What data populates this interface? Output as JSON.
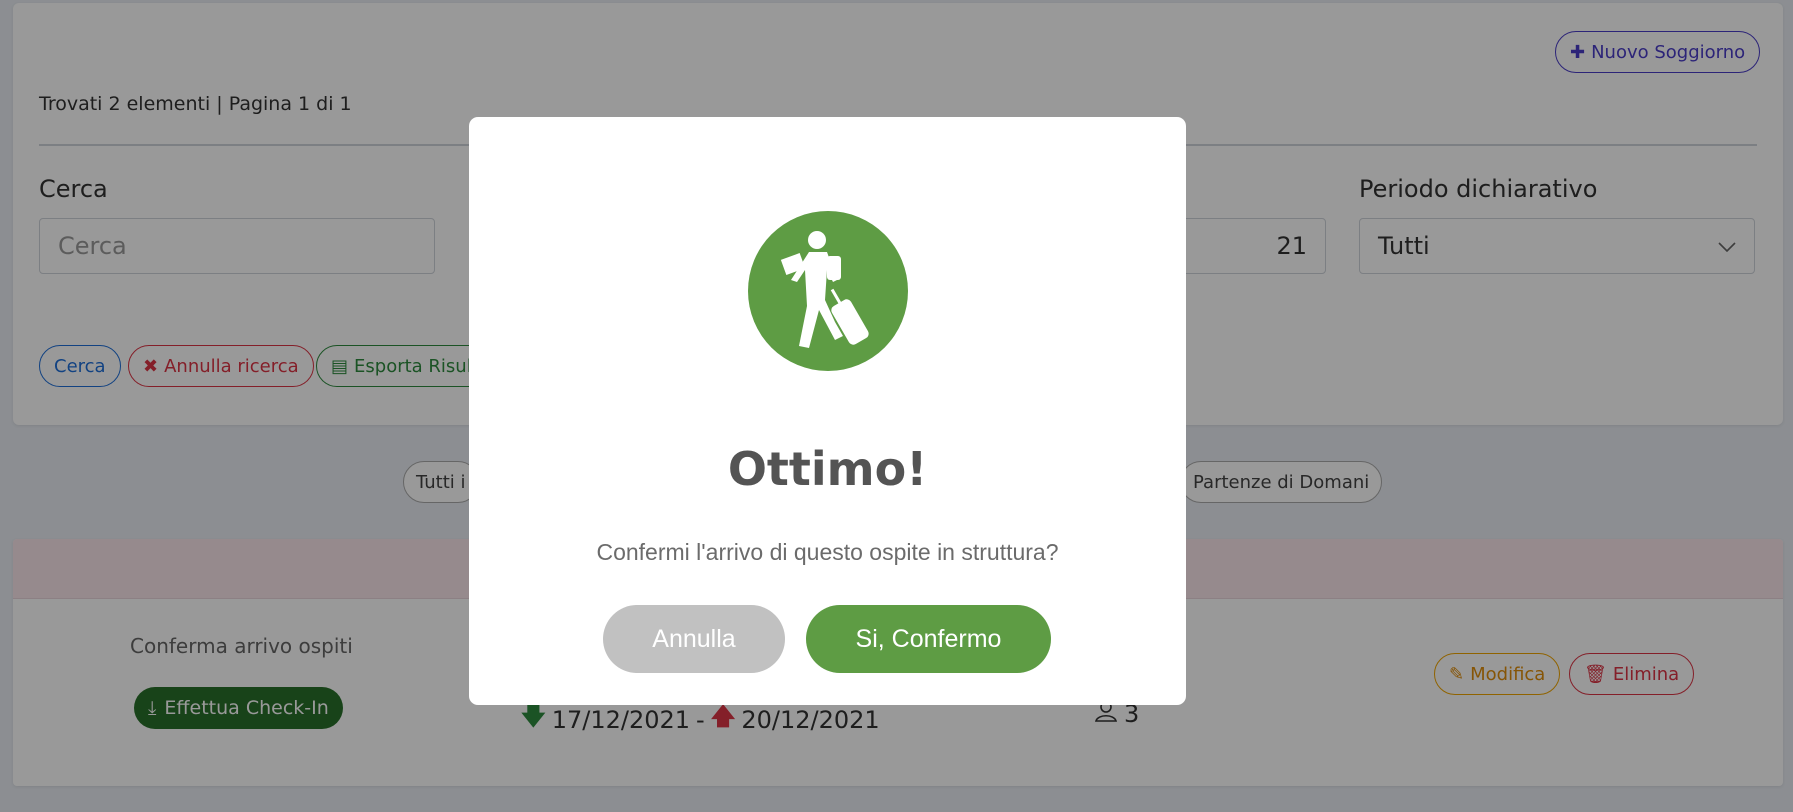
{
  "header": {
    "new_stay_button": "Nuovo Soggiorno",
    "found_text": "Trovati 2 elementi | Pagina 1 di 1"
  },
  "filters": {
    "search_label": "Cerca",
    "search_placeholder": "Cerca",
    "date_partial": "21",
    "period_label": "Periodo dichiarativo",
    "period_value": "Tutti"
  },
  "actions": {
    "search_button": "Cerca",
    "cancel_search_button": "Annulla ricerca",
    "export_button": "Esporta Risult"
  },
  "quick_filters": {
    "all_partial": "Tutti i",
    "tomorrow_departures": "Partenze di Domani"
  },
  "stay": {
    "confirm_label": "Conferma arrivo ospiti",
    "checkin_button": "Effettua Check-In",
    "arrival_date": "17/12/2021",
    "separator": "-",
    "departure_date": "20/12/2021",
    "guest_count": "3",
    "edit_button": "Modifica",
    "delete_button": "Elimina"
  },
  "modal": {
    "title": "Ottimo!",
    "message": "Confermi l'arrivo di questo ospite in struttura?",
    "cancel_button": "Annulla",
    "confirm_button": "Si, Confermo",
    "icon": "traveler-icon",
    "icon_color": "#5e9c44"
  },
  "colors": {
    "primary": "#4a3cc8",
    "success": "#28702a",
    "danger": "#dc3545",
    "warning": "#f0a500"
  }
}
